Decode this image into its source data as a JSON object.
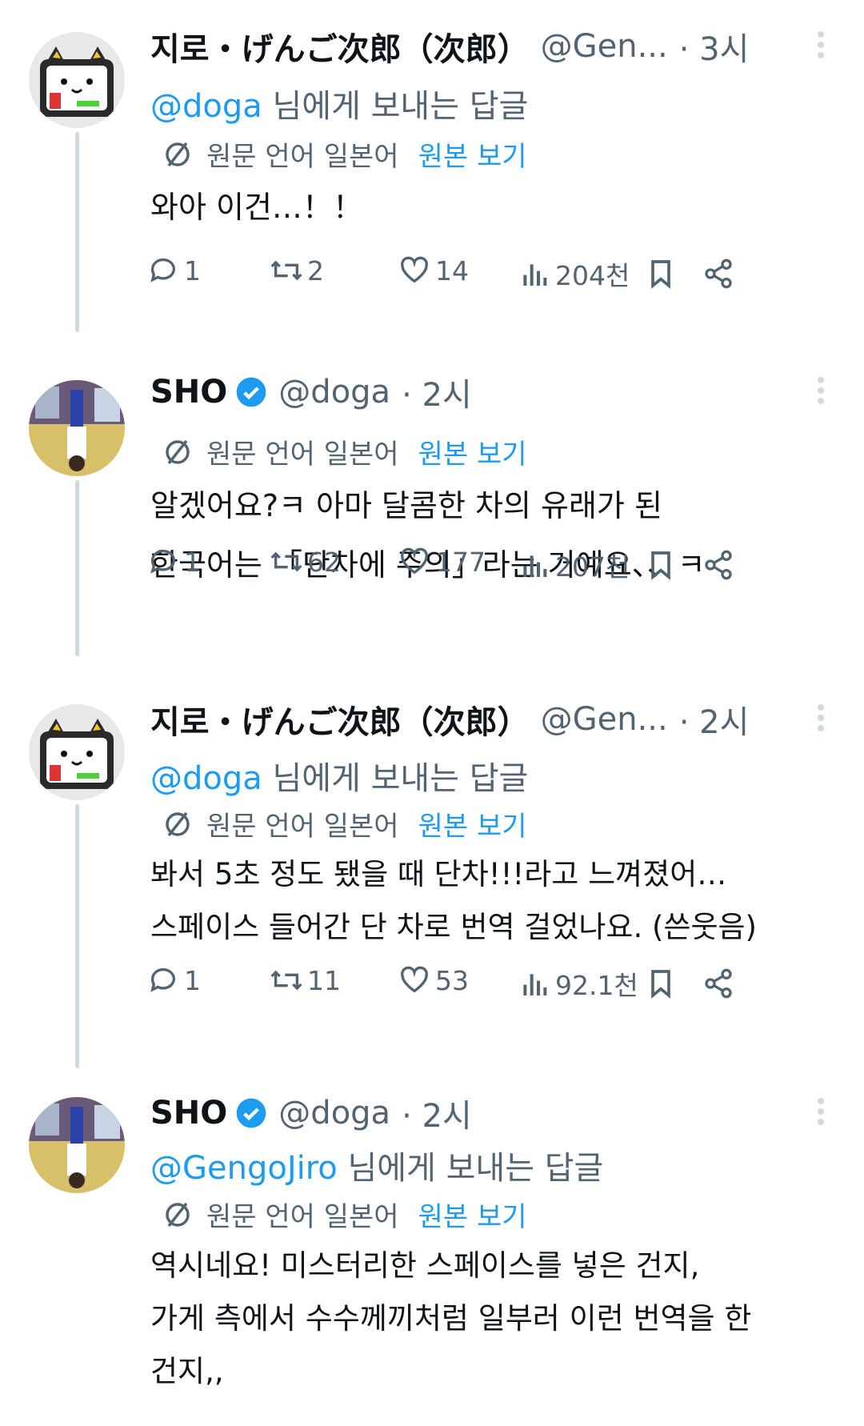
{
  "tweets": [
    {
      "name": "지로・げんご次郎（次郎）",
      "handle": "@Gen...",
      "time": "· 3시",
      "reply_prefix": "@doga",
      "reply_suffix": " 님에게 보내는 답글",
      "translate_label": "원문 언어 일본어",
      "translate_link": "원본 보기",
      "lines": [
        "와아 이건…！！"
      ],
      "replies": "1",
      "retweets": "2",
      "likes": "14",
      "views": "204천"
    },
    {
      "name": "SHO",
      "handle": "@doga",
      "time": "· 2시",
      "translate_label": "원문 언어 일본어",
      "translate_link": "원본 보기",
      "lines": [
        "알겠어요?ㅋ 아마 달콤한 차의 유래가 된",
        "한국어는 「단차에 주의」라는 거예요、、ㅋ"
      ],
      "replies": "1",
      "retweets": "62",
      "likes": "177",
      "views": "207천"
    },
    {
      "name": "지로・げんご次郎（次郎）",
      "handle": "@Gen...",
      "time": "· 2시",
      "reply_prefix": "@doga",
      "reply_suffix": " 님에게 보내는 답글",
      "translate_label": "원문 언어 일본어",
      "translate_link": "원본 보기",
      "lines": [
        "봐서 5초 정도 됐을 때 단차!!!라고 느껴졌어…",
        "스페이스 들어간 단 차로 번역 걸었나요. (쓴웃음)"
      ],
      "replies": "1",
      "retweets": "11",
      "likes": "53",
      "views": "92.1천"
    },
    {
      "name": "SHO",
      "handle": "@doga",
      "time": "· 2시",
      "reply_prefix": "@GengoJiro",
      "reply_suffix": " 님에게 보내는 답글",
      "translate_label": "원문 언어 일본어",
      "translate_link": "원본 보기",
      "lines": [
        "역시네요! 미스터리한 스페이스를 넣은 건지,",
        "가게 측에서 수수께끼처럼 일부러 이런 번역을 한",
        "건지,,"
      ]
    }
  ],
  "colors": {
    "accent": "#1d9bf0",
    "muted": "#536471",
    "text": "#0f1419",
    "thread": "#cfd9de"
  }
}
